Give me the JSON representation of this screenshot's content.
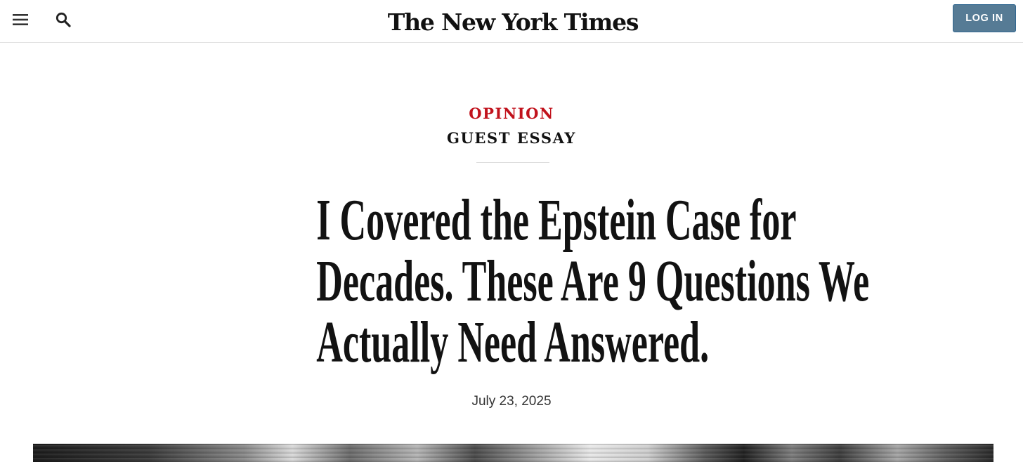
{
  "header": {
    "menu_icon": "hamburger-menu-icon",
    "search_icon": "search-icon",
    "logo_text": "The New York Times",
    "login_label": "LOG IN",
    "login_color": "#567b95"
  },
  "article": {
    "section": "OPINION",
    "section_color": "#c1121c",
    "label": "GUEST ESSAY",
    "headline_lines": [
      "I Covered the Epstein Case for",
      "Decades. These Are 9 Questions We",
      "Actually Need Answered."
    ],
    "date": "July 23, 2025"
  },
  "hero_image": {
    "description_icon": "photo-image"
  }
}
